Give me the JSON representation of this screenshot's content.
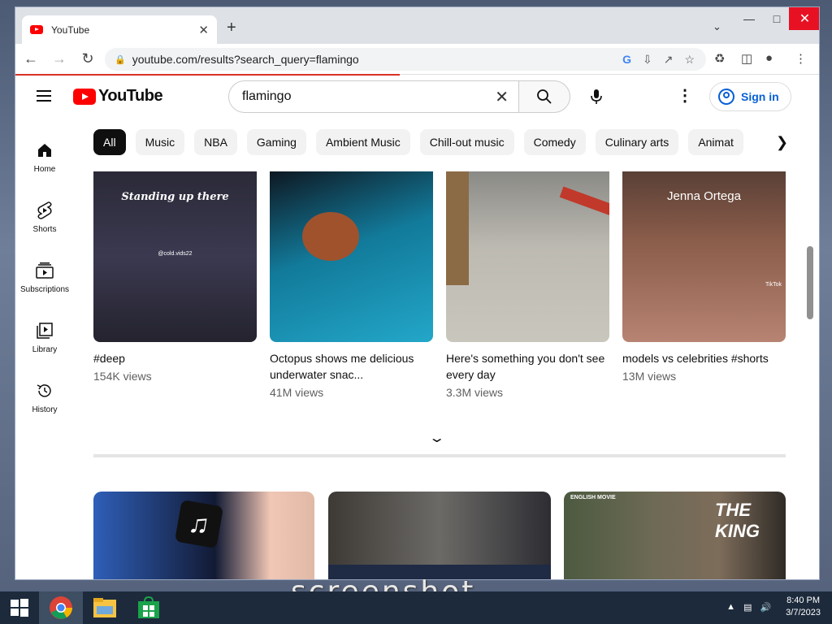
{
  "browser": {
    "tab_title": "YouTube",
    "url": "youtube.com/results?search_query=flamingo",
    "new_tab_glyph": "+",
    "close_tab_glyph": "✕"
  },
  "youtube": {
    "logo_text": "YouTube",
    "search_query": "flamingo",
    "sign_in": "Sign in",
    "guide": [
      {
        "label": "Home",
        "icon": "home-icon"
      },
      {
        "label": "Shorts",
        "icon": "shorts-icon"
      },
      {
        "label": "Subscriptions",
        "icon": "subscriptions-icon"
      },
      {
        "label": "Library",
        "icon": "library-icon"
      },
      {
        "label": "History",
        "icon": "history-icon"
      }
    ],
    "chips": [
      "All",
      "Music",
      "NBA",
      "Gaming",
      "Ambient Music",
      "Chill-out music",
      "Comedy",
      "Culinary arts",
      "Animat"
    ],
    "shorts": [
      {
        "title": "#deep",
        "views": "154K views",
        "overlay": "Standing up there",
        "handle": "@cold.vids22"
      },
      {
        "title": "Octopus shows me delicious underwater snac...",
        "views": "41M views"
      },
      {
        "title": "Here's something you don't see every day",
        "views": "3.3M views"
      },
      {
        "title": "models vs celebrities #shorts",
        "views": "13M views",
        "overlay": "Jenna Ortega",
        "badge": "TikTok"
      }
    ],
    "videos": [
      {
        "overlay": ""
      },
      {
        "overlay": ""
      },
      {
        "overlay_small": "ENGLISH MOVIE",
        "overlay": "THE KING"
      }
    ]
  },
  "watermark": "screenshot.",
  "taskbar": {
    "time": "8:40 PM",
    "date": "3/7/2023"
  },
  "colors": {
    "youtube_red": "#ff0000",
    "link_blue": "#065fd4",
    "taskbar": "#1c2a3c"
  }
}
